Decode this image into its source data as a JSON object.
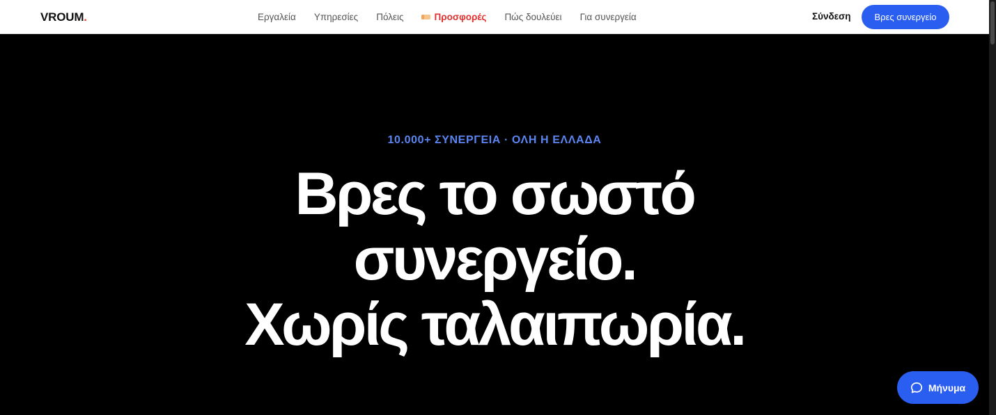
{
  "header": {
    "logo_text": "VROUM",
    "logo_dot": ".",
    "nav": [
      {
        "label": "Εργαλεία"
      },
      {
        "label": "Υπηρεσίες"
      },
      {
        "label": "Πόλεις"
      },
      {
        "label": "Προσφορές",
        "icon": "tag-icon",
        "highlight": true
      },
      {
        "label": "Πώς δουλεύει"
      },
      {
        "label": "Για συνεργεία"
      }
    ],
    "login_label": "Σύνδεση",
    "cta_label": "Βρες συνεργείο"
  },
  "hero": {
    "eyebrow": "10.000+ ΣΥΝΕΡΓΕΙΑ · ΟΛΗ Η ΕΛΛΑΔΑ",
    "headline_lines": [
      "Βρες το σωστό",
      "συνεργείο.",
      "Χωρίς ταλαιπωρία."
    ]
  },
  "chat": {
    "label": "Μήνυμα",
    "icon": "chat-bubble-icon"
  },
  "colors": {
    "accent_blue": "#2a5ef0",
    "eyebrow_blue": "#5b86f2",
    "offers_red": "#e0312f",
    "logo_dot_red": "#e8452c",
    "hero_background": "#000000"
  }
}
